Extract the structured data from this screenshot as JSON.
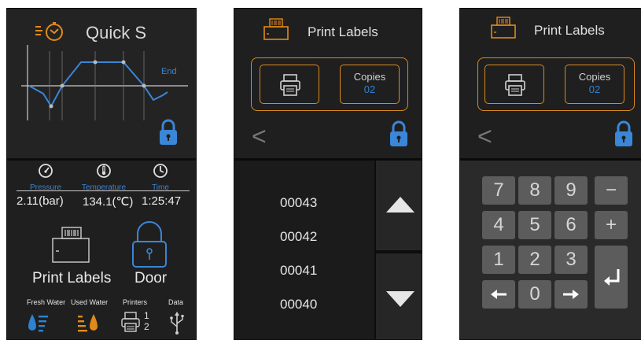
{
  "quick_screen": {
    "title": "Quick S",
    "graph": {
      "end_label": "End"
    },
    "stats": [
      {
        "label": "Pressure",
        "icon": "gauge-icon"
      },
      {
        "label": "Temperature",
        "icon": "thermometer-icon"
      },
      {
        "label": "Time",
        "icon": "clock-icon"
      }
    ],
    "readings": {
      "pressure": "2.11(bar)",
      "temperature": "134.1(℃)",
      "time": "1:25:47"
    },
    "print_labels": "Print Labels",
    "door": "Door",
    "bottom": {
      "fresh_water": "Fresh Water",
      "used_water": "Used Water",
      "printers": "Printers",
      "printer_1": "1",
      "printer_2": "2",
      "data": "Data"
    }
  },
  "print_screen": {
    "title": "Print Labels",
    "copies_label": "Copies",
    "copies_value": "02",
    "list": [
      "00043",
      "00042",
      "00041",
      "00040"
    ]
  },
  "keypad_screen": {
    "title": "Print Labels",
    "copies_label": "Copies",
    "copies_value": "02",
    "keys": [
      "7",
      "8",
      "9",
      "−",
      "4",
      "5",
      "6",
      "+",
      "1",
      "2",
      "3",
      "0"
    ]
  },
  "colors": {
    "accent": "#d98a1e",
    "blue": "#2f82d0",
    "background": "#1f1f1f"
  }
}
